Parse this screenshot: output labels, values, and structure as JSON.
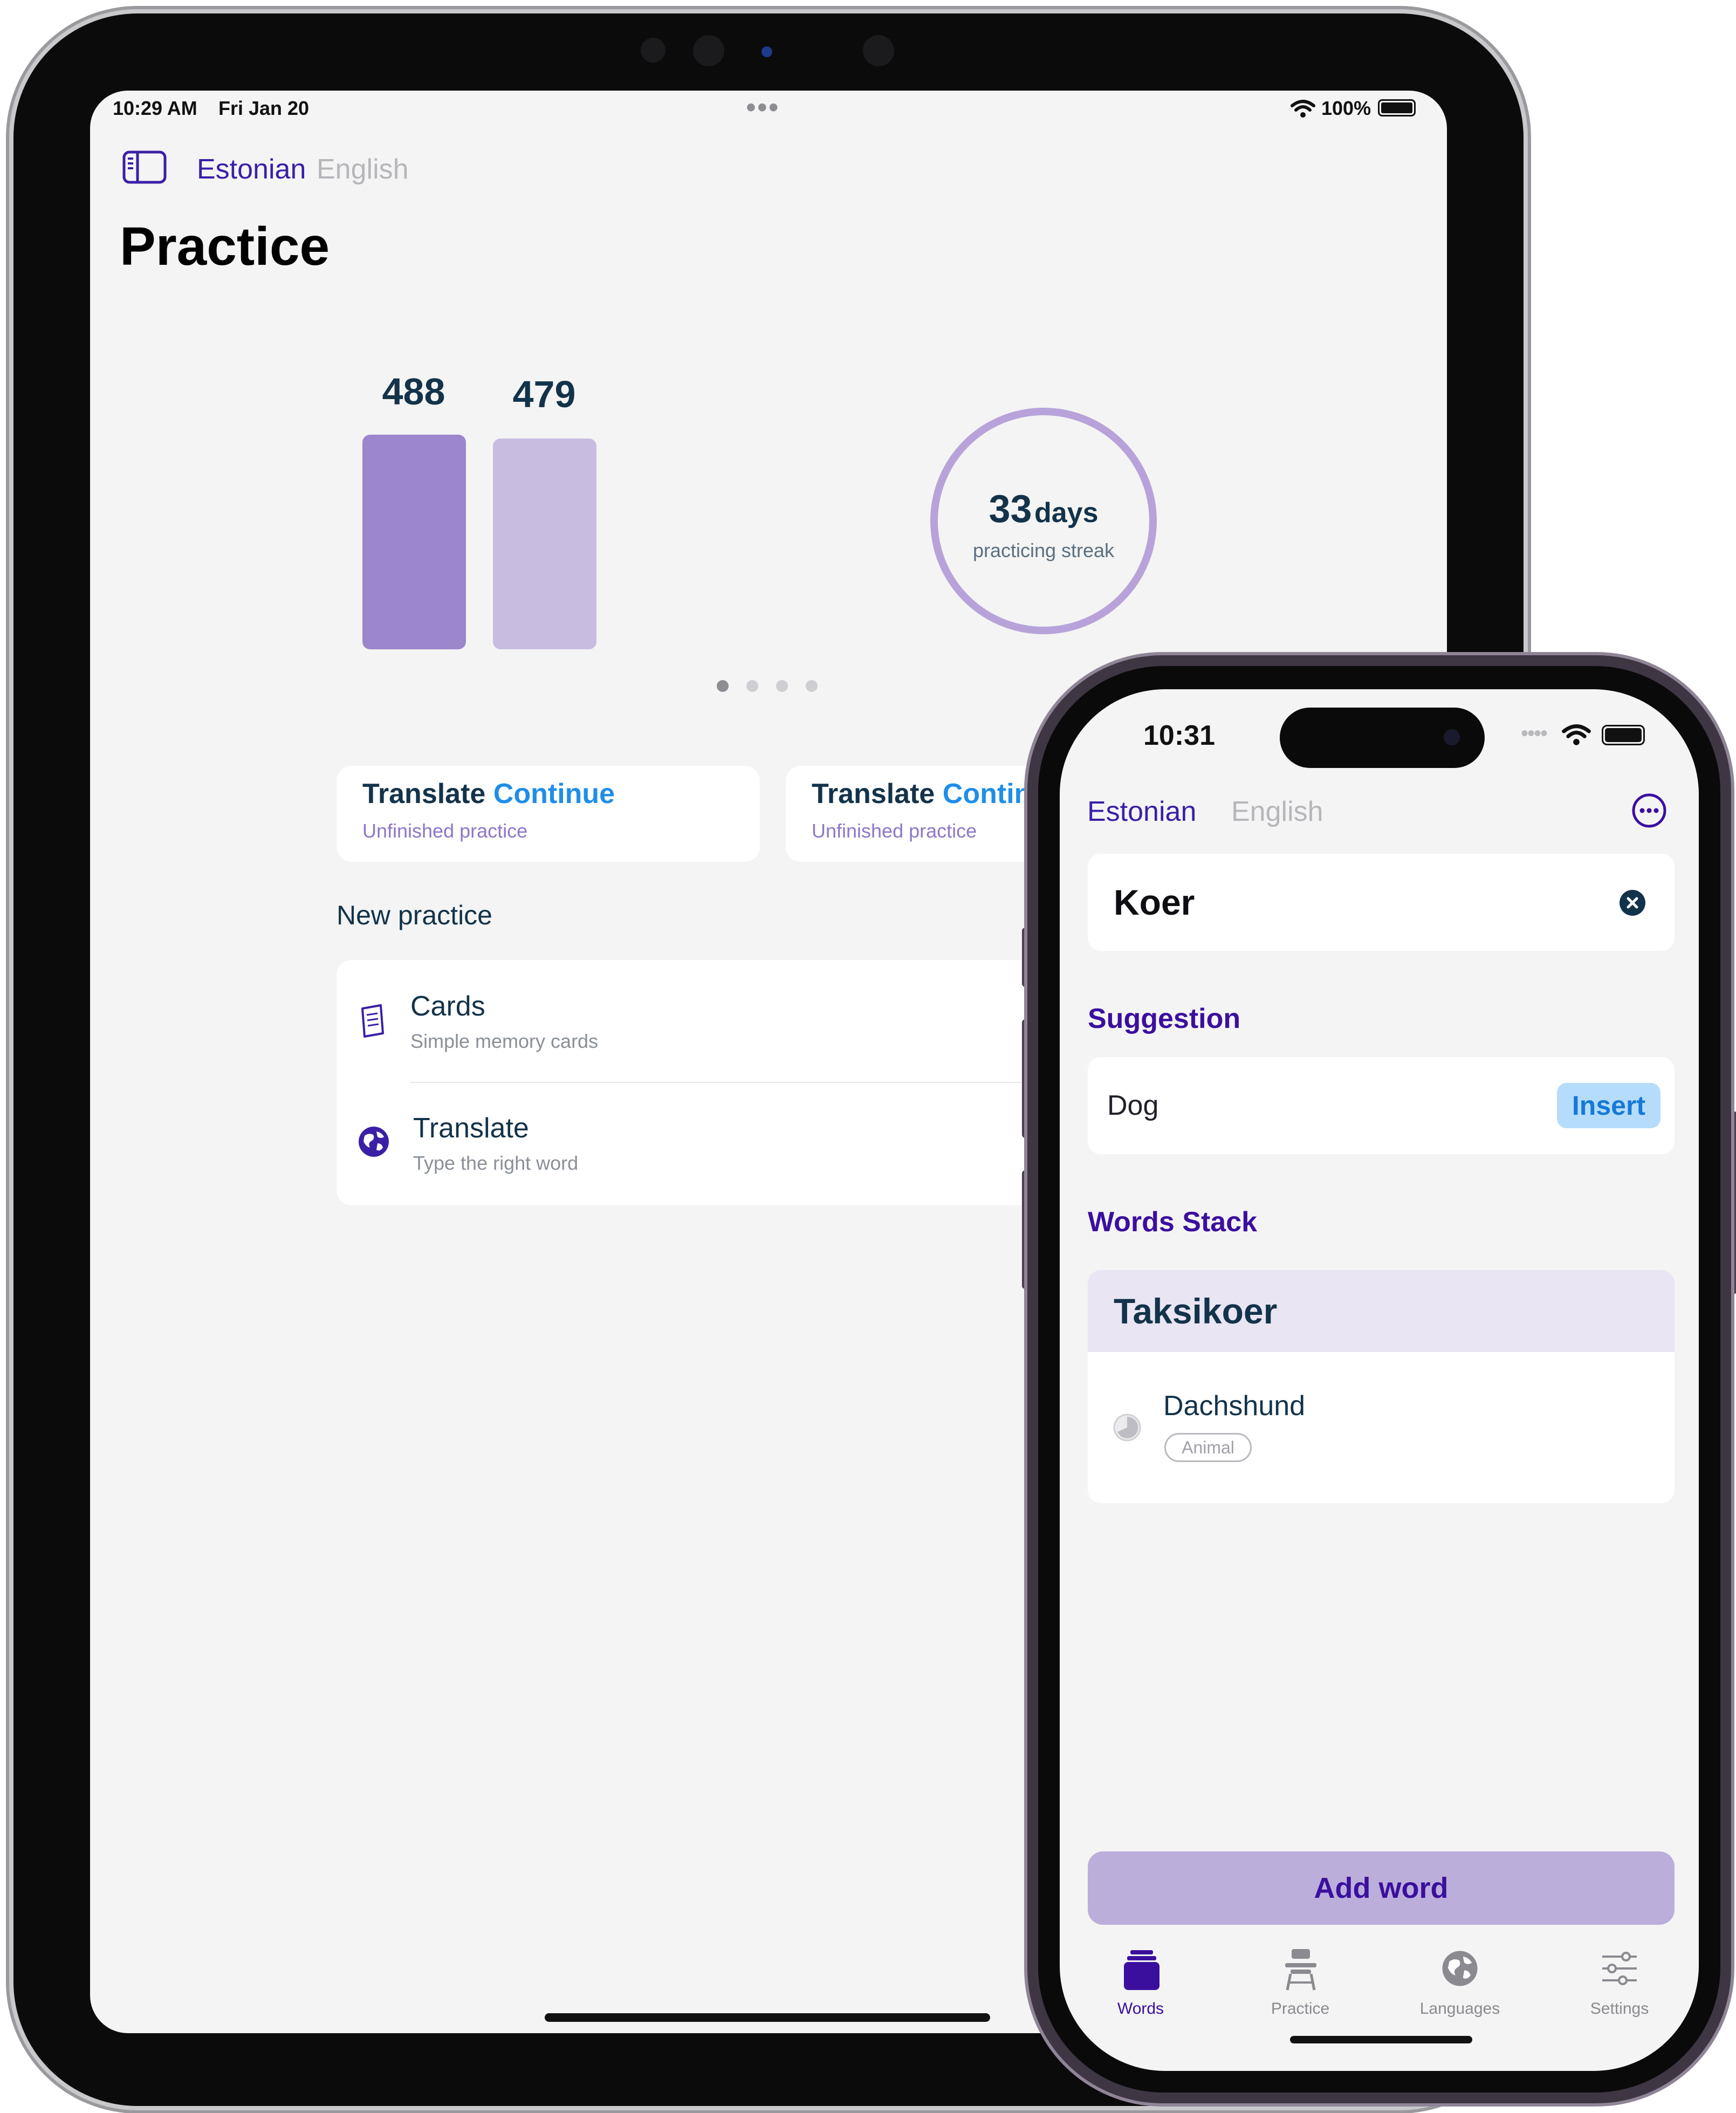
{
  "ipad": {
    "status": {
      "time": "10:29 AM",
      "date": "Fri Jan 20",
      "battery": "100%"
    },
    "top_dots": "•••",
    "lang_active": "Estonian",
    "lang_inactive": "English",
    "title": "Practice",
    "stats": {
      "bar1_value": 488,
      "bar2_value": 479,
      "bar1_label": "488",
      "bar2_label": "479",
      "bar1_color": "#9b87cc",
      "bar2_color": "#c8bde1",
      "streak_number": "33",
      "streak_unit": "days",
      "streak_label": "practicing streak"
    },
    "continue_cards": [
      {
        "title": "Translate",
        "link": "Continue",
        "sub": "Unfinished practice"
      },
      {
        "title": "Translate",
        "link": "Contin",
        "sub": "Unfinished practice"
      }
    ],
    "new_practice_heading": "New practice",
    "new_practice_items": [
      {
        "title": "Cards",
        "sub": "Simple memory cards",
        "icon": "card-icon"
      },
      {
        "title": "Translate",
        "sub": "Type the right word",
        "icon": "globe-icon"
      }
    ],
    "page_dots": {
      "count": 4,
      "active": 1
    }
  },
  "iphone": {
    "status": {
      "time": "10:31"
    },
    "lang_active": "Estonian",
    "lang_inactive": "English",
    "search_value": "Koer",
    "suggestion_heading": "Suggestion",
    "suggestion_value": "Dog",
    "insert_label": "Insert",
    "stack_heading": "Words Stack",
    "stack_title": "Taksikoer",
    "stack_word": "Dachshund",
    "stack_tag": "Animal",
    "add_word_label": "Add word",
    "tabs": [
      {
        "label": "Words",
        "icon": "stack-icon",
        "active": true
      },
      {
        "label": "Practice",
        "icon": "desk-icon",
        "active": false
      },
      {
        "label": "Languages",
        "icon": "globe-icon",
        "active": false
      },
      {
        "label": "Settings",
        "icon": "sliders-icon",
        "active": false
      }
    ],
    "colors": {
      "accent": "#3b0f9e",
      "link": "#1f8ee8"
    }
  }
}
